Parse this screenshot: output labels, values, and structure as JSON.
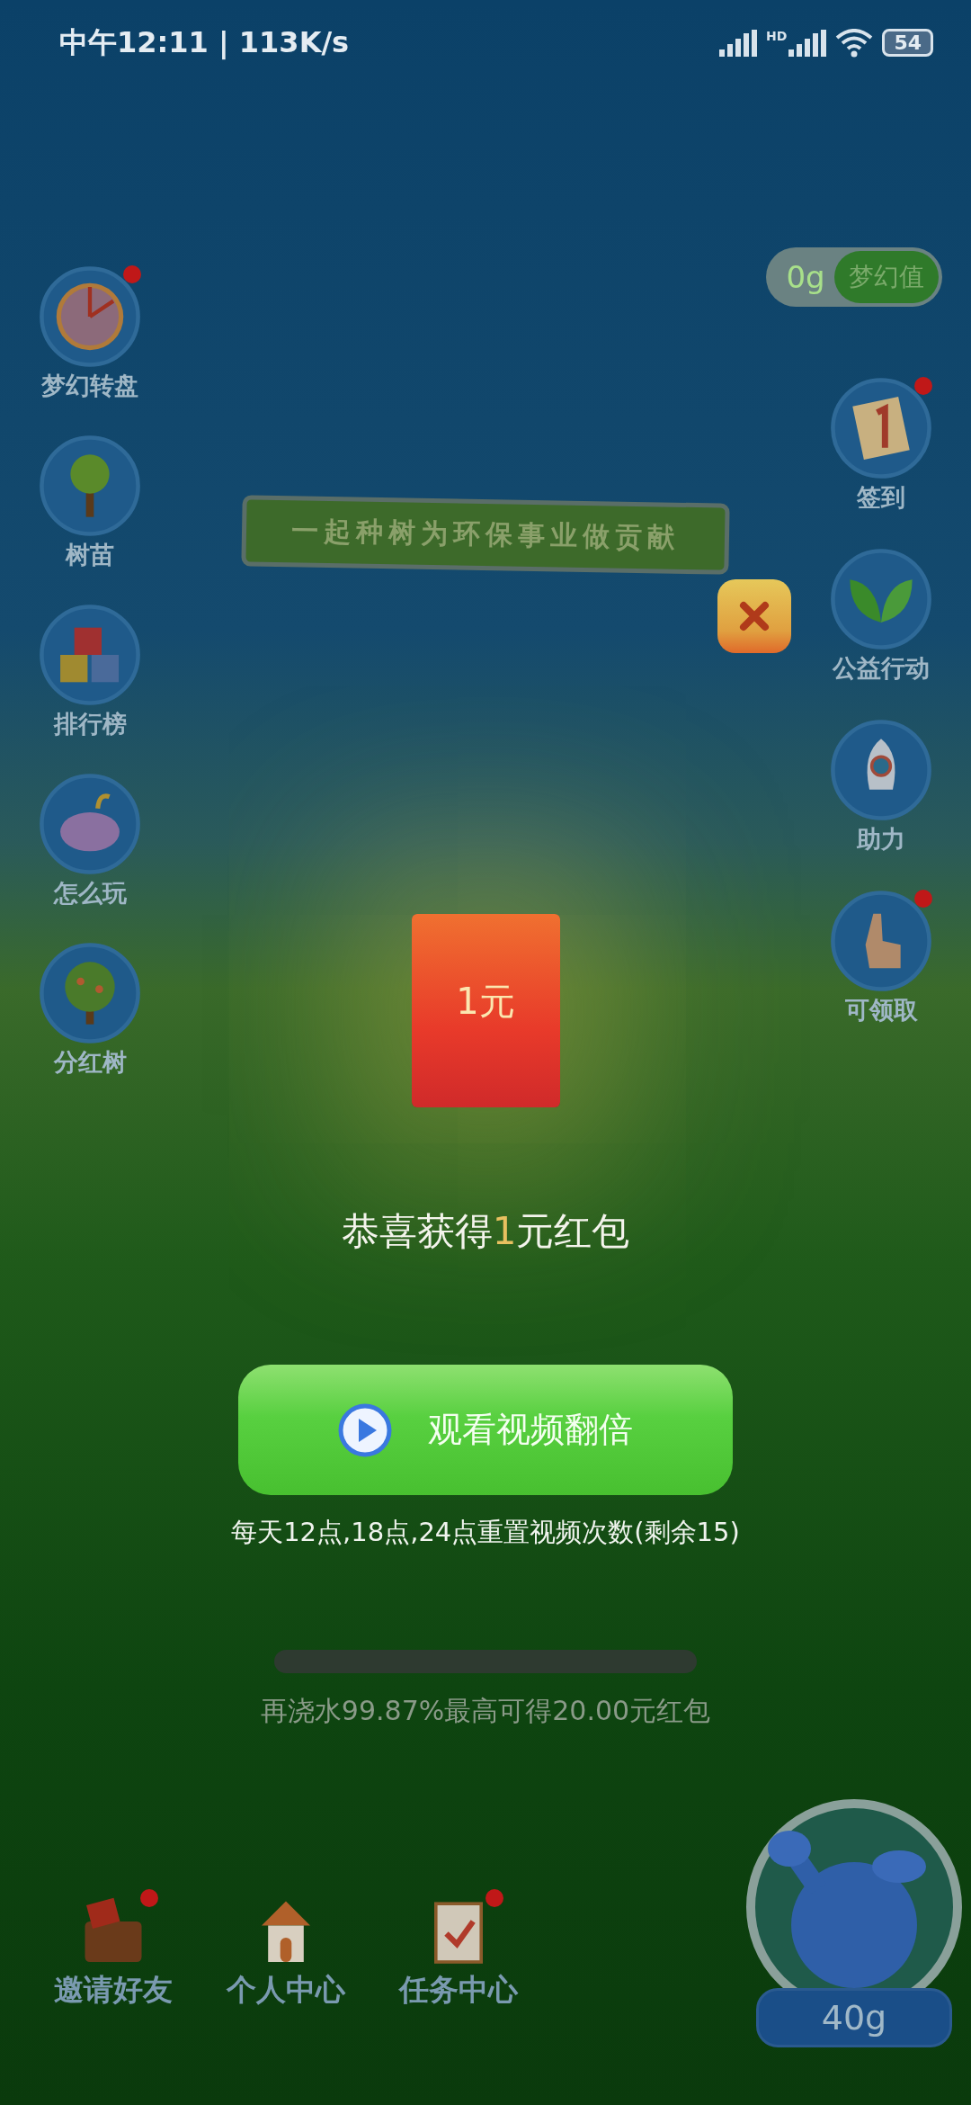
{
  "status_bar": {
    "time": "中午12:11 | 113K/s",
    "network": "HD",
    "battery": "54"
  },
  "dream_value": {
    "amount": "0g",
    "label": "梦幻值"
  },
  "left_menu": [
    {
      "label": "梦幻转盘",
      "badge": true
    },
    {
      "label": "树苗",
      "badge": false
    },
    {
      "label": "排行榜",
      "badge": false
    },
    {
      "label": "怎么玩",
      "badge": false
    },
    {
      "label": "分红树",
      "badge": false
    }
  ],
  "right_menu": [
    {
      "label": "签到",
      "badge": true
    },
    {
      "label": "公益行动",
      "badge": false
    },
    {
      "label": "助力",
      "badge": false
    },
    {
      "label": "可领取",
      "badge": true
    }
  ],
  "banner": "一起种树为环保事业做贡献",
  "reward_dialog": {
    "packet_amount": "1元",
    "title": "恭喜获得**1**元红包",
    "button": "观看视频翻倍",
    "note": "每天12点,18点,24点重置视频次数(剩余15)"
  },
  "progress": {
    "level": 0,
    "caption": "再浇水99.87%最高可得20.00元红包"
  },
  "bottom_menu": [
    {
      "label": "邀请好友",
      "badge": true
    },
    {
      "label": "个人中心",
      "badge": false
    },
    {
      "label": "任务中心",
      "badge": true
    }
  ],
  "watering_can": {
    "amount": "40g"
  }
}
